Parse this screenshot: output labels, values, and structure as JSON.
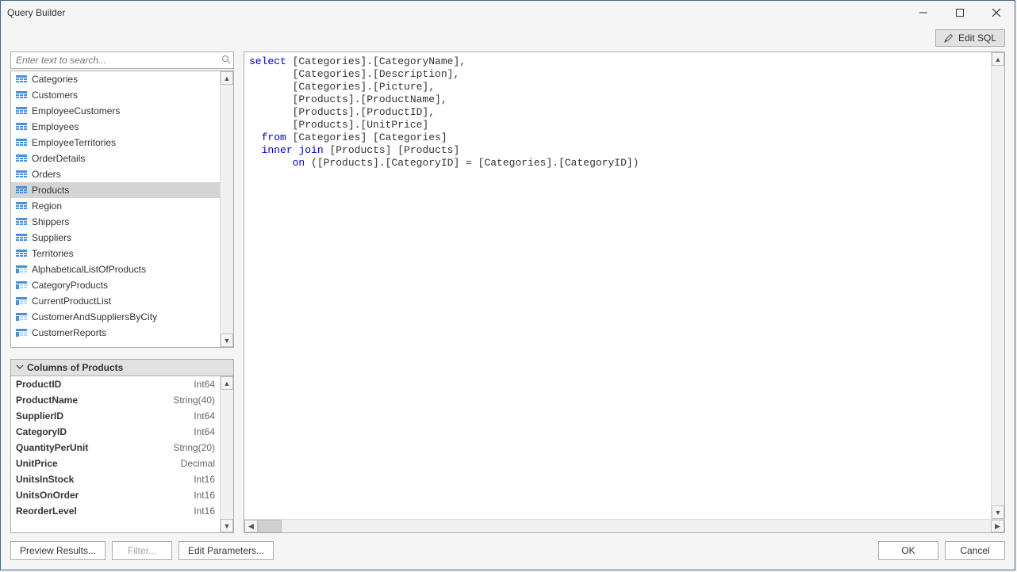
{
  "window": {
    "title": "Query Builder"
  },
  "toolbar": {
    "edit_sql": "Edit SQL"
  },
  "search": {
    "placeholder": "Enter text to search..."
  },
  "tables": {
    "items": [
      {
        "name": "Categories",
        "kind": "table"
      },
      {
        "name": "Customers",
        "kind": "table"
      },
      {
        "name": "EmployeeCustomers",
        "kind": "table"
      },
      {
        "name": "Employees",
        "kind": "table"
      },
      {
        "name": "EmployeeTerritories",
        "kind": "table"
      },
      {
        "name": "OrderDetails",
        "kind": "table"
      },
      {
        "name": "Orders",
        "kind": "table"
      },
      {
        "name": "Products",
        "kind": "table"
      },
      {
        "name": "Region",
        "kind": "table"
      },
      {
        "name": "Shippers",
        "kind": "table"
      },
      {
        "name": "Suppliers",
        "kind": "table"
      },
      {
        "name": "Territories",
        "kind": "table"
      },
      {
        "name": "AlphabeticalListOfProducts",
        "kind": "view"
      },
      {
        "name": "CategoryProducts",
        "kind": "view"
      },
      {
        "name": "CurrentProductList",
        "kind": "view"
      },
      {
        "name": "CustomerAndSuppliersByCity",
        "kind": "view"
      },
      {
        "name": "CustomerReports",
        "kind": "view"
      }
    ],
    "selected_index": 7
  },
  "columns_header": "Columns of Products",
  "columns": [
    {
      "name": "ProductID",
      "type": "Int64"
    },
    {
      "name": "ProductName",
      "type": "String(40)"
    },
    {
      "name": "SupplierID",
      "type": "Int64"
    },
    {
      "name": "CategoryID",
      "type": "Int64"
    },
    {
      "name": "QuantityPerUnit",
      "type": "String(20)"
    },
    {
      "name": "UnitPrice",
      "type": "Decimal"
    },
    {
      "name": "UnitsInStock",
      "type": "Int16"
    },
    {
      "name": "UnitsOnOrder",
      "type": "Int16"
    },
    {
      "name": "ReorderLevel",
      "type": "Int16"
    }
  ],
  "sql": {
    "tokens": [
      {
        "t": "select",
        "k": true
      },
      {
        "t": " [Categories].[CategoryName],\n"
      },
      {
        "t": "       [Categories].[Description],\n"
      },
      {
        "t": "       [Categories].[Picture],\n"
      },
      {
        "t": "       [Products].[ProductName],\n"
      },
      {
        "t": "       [Products].[ProductID],\n"
      },
      {
        "t": "       [Products].[UnitPrice]\n"
      },
      {
        "t": "  "
      },
      {
        "t": "from",
        "k": true
      },
      {
        "t": " [Categories] [Categories]\n"
      },
      {
        "t": "  "
      },
      {
        "t": "inner",
        "k": true
      },
      {
        "t": " "
      },
      {
        "t": "join",
        "k": true
      },
      {
        "t": " [Products] [Products]\n"
      },
      {
        "t": "       "
      },
      {
        "t": "on",
        "k": true
      },
      {
        "t": " ([Products].[CategoryID] = [Categories].[CategoryID])"
      }
    ]
  },
  "footer": {
    "preview": "Preview Results...",
    "filter": "Filter...",
    "edit_params": "Edit Parameters...",
    "ok": "OK",
    "cancel": "Cancel"
  }
}
